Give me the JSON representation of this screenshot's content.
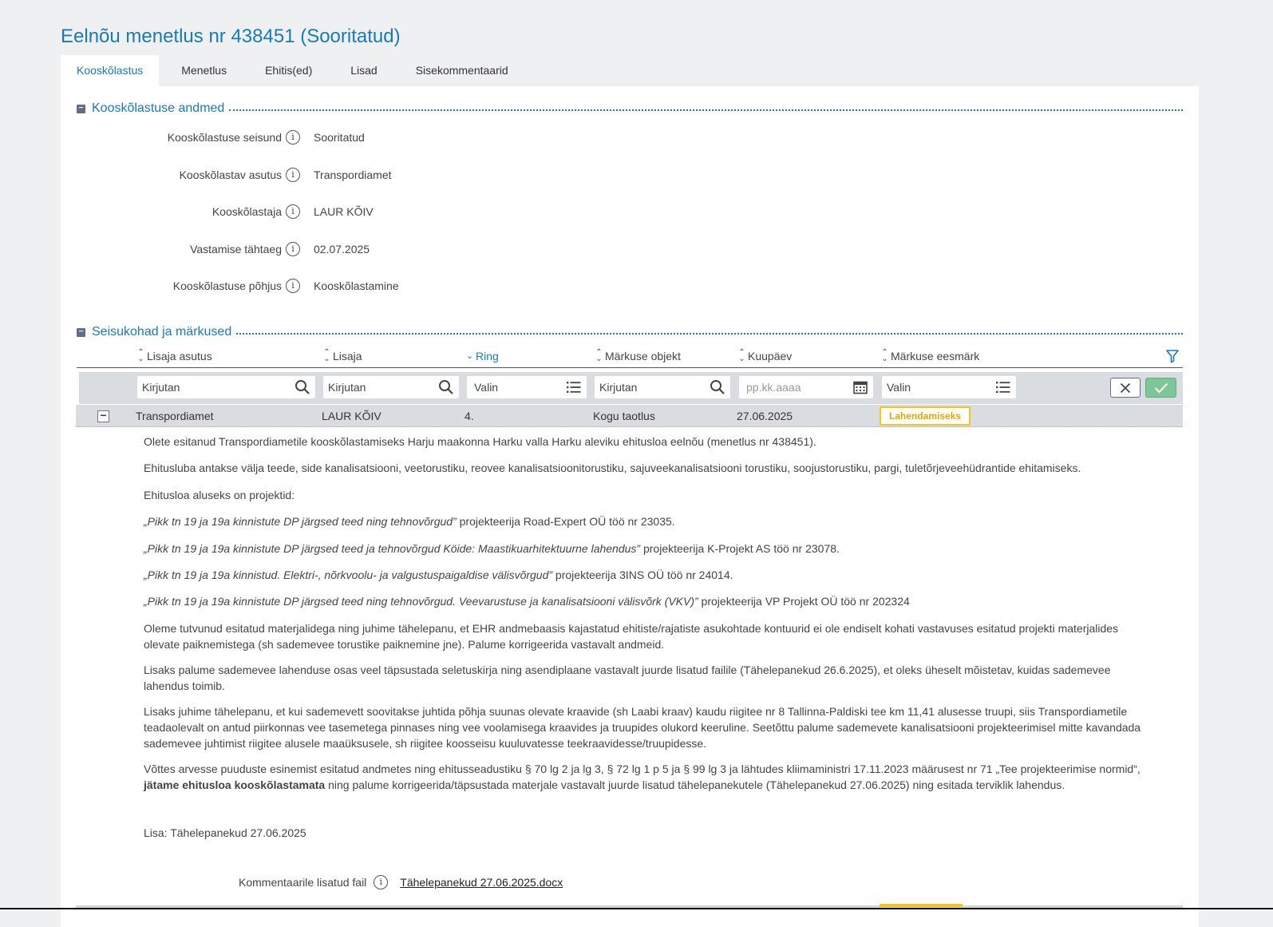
{
  "page": {
    "title": "Eelnõu menetlus nr 438451 (Sooritatud)"
  },
  "tabs": [
    {
      "label": "Kooskõlastus",
      "active": true
    },
    {
      "label": "Menetlus"
    },
    {
      "label": "Ehitis(ed)"
    },
    {
      "label": "Lisad"
    },
    {
      "label": "Sisekommentaarid"
    }
  ],
  "section1": {
    "toggle": "−",
    "title": "Kooskõlastuse andmed",
    "fields": [
      {
        "label": "Kooskõlastuse seisund",
        "value": "Sooritatud"
      },
      {
        "label": "Kooskõlastav asutus",
        "value": "Transpordiamet"
      },
      {
        "label": "Kooskõlastaja",
        "value": "LAUR KÕIV"
      },
      {
        "label": "Vastamise tähtaeg",
        "value": "02.07.2025"
      },
      {
        "label": "Kooskõlastuse põhjus",
        "value": "Kooskõlastamine"
      }
    ]
  },
  "section2": {
    "toggle": "−",
    "title": "Seisukohad ja märkused"
  },
  "table": {
    "columns": [
      "Lisaja asutus",
      "Lisaja",
      "Ring",
      "Märkuse objekt",
      "Kuupäev",
      "Märkuse eesmärk"
    ],
    "sorted_column": "Ring",
    "filters": {
      "lisaja_asutus": "Kirjutan",
      "lisaja": "Kirjutan",
      "ring": "Valin",
      "objekt": "Kirjutan",
      "kuupaev": "pp.kk.aaaa",
      "eesmark": "Valin"
    },
    "row": {
      "toggle": "−",
      "asutus": "Transpordiamet",
      "lisaja": "LAUR KÕIV",
      "ring": "4.",
      "objekt": "Kogu taotlus",
      "kuupaev": "27.06.2025",
      "eesmark": "Lahendamiseks"
    }
  },
  "comment": {
    "p1": "Olete esitanud Transpordiametile kooskõlastamiseks Harju maakonna Harku valla Harku aleviku ehitusloa eelnõu (menetlus nr 438451).",
    "p2": "Ehitusluba antakse välja teede, side kanalisatsiooni, veetorustiku, reovee kanalisatsioonitorustiku, sajuveekanalisatsiooni torustiku, soojustorustiku, pargi, tuletõrjeveehüdrantide ehitamiseks.",
    "p3": "Ehitusloa aluseks on projektid:",
    "proj1_italic": "„Pikk tn 19 ja 19a kinnistute DP järgsed teed ning tehnovõrgud”",
    "proj1_rest": " projekteerija Road-Expert OÜ töö nr 23035.",
    "proj2_italic": "„Pikk tn 19 ja 19a kinnistute DP järgsed teed ja tehnovõrgud Köide: Maastikuarhitektuurne lahendus”",
    "proj2_rest": " projekteerija K-Projekt AS töö nr 23078.",
    "proj3_italic": "„Pikk tn 19 ja 19a kinnistud. Elektri-, nõrkvoolu- ja valgustuspaigaldise välisvõrgud”",
    "proj3_rest": " projekteerija 3INS OÜ töö nr 24014.",
    "proj4_italic": "„Pikk tn 19 ja 19a kinnistute DP järgsed teed ning tehnovõrgud. Veevarustuse ja kanalisatsiooni välisvõrk (VKV)”",
    "proj4_rest": " projekteerija VP Projekt OÜ töö nr 202324",
    "p4": "Oleme tutvunud esitatud materjalidega ning juhime tähelepanu, et EHR andmebaasis kajastatud ehitiste/rajatiste asukohtade kontuurid ei ole endiselt kohati vastavuses esitatud projekti materjalides olevate paiknemistega (sh sademevee torustike paiknemine jne). Palume korrigeerida vastavalt andmeid.",
    "p5": "Lisaks palume sademevee lahenduse osas veel täpsustada seletuskirja ning asendiplaane vastavalt juurde lisatud failile (Tähelepanekud 26.6.2025), et oleks üheselt mõistetav, kuidas sademevee lahendus toimib.",
    "p6": "Lisaks juhime tähelepanu, et kui sademevett soovitakse juhtida põhja suunas olevate kraavide (sh Laabi kraav) kaudu riigitee nr 8 Tallinna-Paldiski tee km 11,41 alusesse truupi, siis Transpordiametile teadaolevalt on antud piirkonnas vee tasemetega pinnases ning vee voolamisega kraavides ja truupides olukord keeruline. Seetõttu palume sademevete kanalisatsiooni projekteerimisel mitte kavandada sademevee juhtimist riigitee alusele maaüksusele, sh riigitee koosseisu kuuluvatesse teekraavidesse/truupidesse.",
    "p7_start": "Võttes arvesse puuduste esinemist esitatud andmetes ning ehitusseadustiku § 70 lg 2 ja lg 3, § 72 lg 1 p 5 ja § 99 lg 3 ja lähtudes kliimaministri 17.11.2023 määrusest nr 71 „Tee projekteerimise normid“,",
    "p7_bold": "jätame ehitusloa kooskõlastamata",
    "p7_end": " ning palume korrigeerida/täpsustada materjale vastavalt juurde lisatud tähelepanekutele (Tähelepanekud 27.06.2025) ning esitada terviklik lahendus.",
    "lisa": "Lisa: Tähelepanekud 27.06.2025",
    "attachment_label": "Kommentaarile lisatud fail",
    "attachment_link": "Tähelepanekud 27.06.2025.docx"
  },
  "colors": {
    "accent": "#1a7bb3",
    "badge": "#f5c51e",
    "ok": "#7ec698",
    "filter_bg": "#d9dde2"
  },
  "icons": [
    "info-icon",
    "sort-icon",
    "filter-icon",
    "search-icon",
    "list-icon",
    "calendar-icon",
    "close-icon",
    "check-icon",
    "collapse-icon"
  ]
}
